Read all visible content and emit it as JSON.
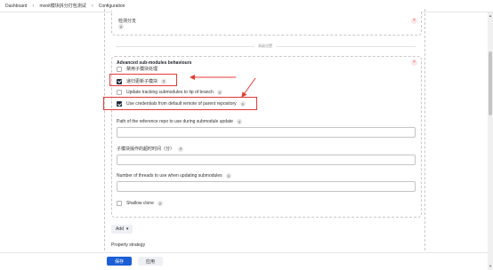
{
  "breadcrumb": {
    "items": [
      "Dashboard",
      "monit模块拆分打包测试",
      "Configuration"
    ],
    "separator": "›"
  },
  "top_box": {
    "label": "检测分支",
    "help": "?"
  },
  "divider_label": "高级设置",
  "advanced": {
    "title": "Advanced sub-modules behaviours",
    "options": [
      {
        "label": "禁用子模块处理",
        "checked": false
      },
      {
        "label": "递归更新子模块",
        "checked": true
      },
      {
        "label": "Update tracking submodules to tip of branch",
        "checked": false
      },
      {
        "label": "Use credentials from default remote of parent repository",
        "checked": true
      }
    ],
    "fields": [
      {
        "label": "Path of the reference repo to use during submodule update",
        "value": ""
      },
      {
        "label": "子模块操作的超时时间（分）",
        "value": ""
      },
      {
        "label": "Number of threads to use when updating submodules",
        "value": ""
      }
    ],
    "shallow_clone_label": "Shallow clone",
    "shallow_clone_checked": false,
    "close_symbol": "×"
  },
  "add_button": {
    "label": "Add",
    "chevron": "▾"
  },
  "property_strategy_label": "Property strategy",
  "bottom_bar": {
    "save_label": "保存",
    "apply_label": "应用"
  },
  "help_symbol": "?",
  "colors": {
    "annotation_red": "#e53935",
    "primary_button": "#1a5fd6",
    "checkbox_checked": "#1f2a3c"
  }
}
